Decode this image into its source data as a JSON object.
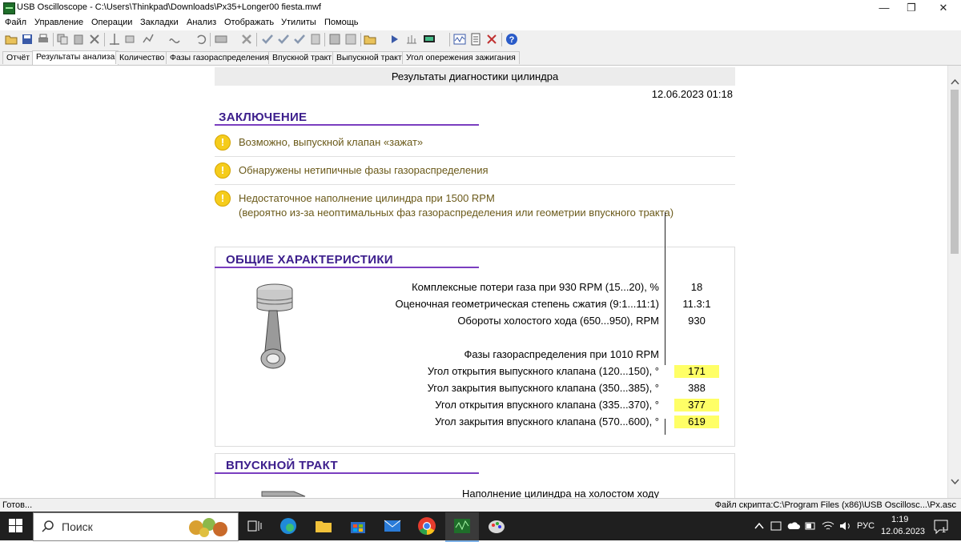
{
  "window": {
    "title": "USB Oscilloscope - C:\\Users\\Thinkpad\\Downloads\\Px35+Longer00 fiesta.mwf",
    "minimize": "—",
    "restore": "❐",
    "close": "✕"
  },
  "menu": [
    "Файл",
    "Управление",
    "Операции",
    "Закладки",
    "Анализ",
    "Отображать",
    "Утилиты",
    "Помощь"
  ],
  "tabs": [
    "Отчёт",
    "Результаты анализа",
    "Количество",
    "Фазы газораспределения",
    "Впускной тракт",
    "Выпускной тракт",
    "Угол опережения зажигания"
  ],
  "report": {
    "header": "Результаты диагностики цилиндра",
    "date": "12.06.2023 01:18",
    "conclusion": {
      "title": "ЗАКЛЮЧЕНИЕ",
      "items": [
        {
          "icon": "warning-icon",
          "text": "Возможно, выпускной клапан «зажат»",
          "text2": ""
        },
        {
          "icon": "warning-icon",
          "text": "Обнаружены нетипичные фазы газораспределения",
          "text2": ""
        },
        {
          "icon": "warning-icon",
          "text": "Недостаточное наполнение цилиндра при 1500 RPM",
          "text2": "(вероятно из-за неоптимальных фаз газораспределения или геометрии впускного тракта)"
        }
      ]
    },
    "general": {
      "title": "ОБЩИЕ ХАРАКТЕРИСТИКИ",
      "image": "piston-image",
      "rows": [
        {
          "label": "Комплексные потери газа при 930 RPM (15...20), %",
          "value": "18",
          "highlight": false
        },
        {
          "label": "Оценочная геометрическая степень сжатия (9:1...11:1)",
          "value": "11.3:1",
          "highlight": false
        },
        {
          "label": "Обороты холостого хода (650...950), RPM",
          "value": "930",
          "highlight": false
        },
        {
          "label": "Фазы газораспределения при 1010 RPM",
          "value": "",
          "highlight": false
        },
        {
          "label": "Угол открытия выпускного клапана (120...150), °",
          "value": "171",
          "highlight": true
        },
        {
          "label": "Угол закрытия выпускного клапана (350...385), °",
          "value": "388",
          "highlight": false
        },
        {
          "label": "Угол открытия впускного клапана (335...370), °",
          "value": "377",
          "highlight": true
        },
        {
          "label": "Угол закрытия впускного клапана (570...600), °",
          "value": "619",
          "highlight": true
        }
      ]
    },
    "intake": {
      "title": "ВПУСКНОЙ ТРАКТ",
      "first_row": "Наполнение цилиндра на холостом ходу"
    }
  },
  "colors": {
    "accent": "#7a3ec0",
    "title": "#3c1e8c",
    "warning": "#f5cc1c",
    "highlight": "#ffff66"
  },
  "status": {
    "left": "Готов...",
    "right": "Файл скрипта:C:\\Program Files (x86)\\USB Oscillosc...\\Px.asc"
  },
  "taskbar": {
    "search_placeholder": "Поиск",
    "lang": "РУС",
    "time": "1:19",
    "date": "12.06.2023",
    "notif_count": "1"
  }
}
